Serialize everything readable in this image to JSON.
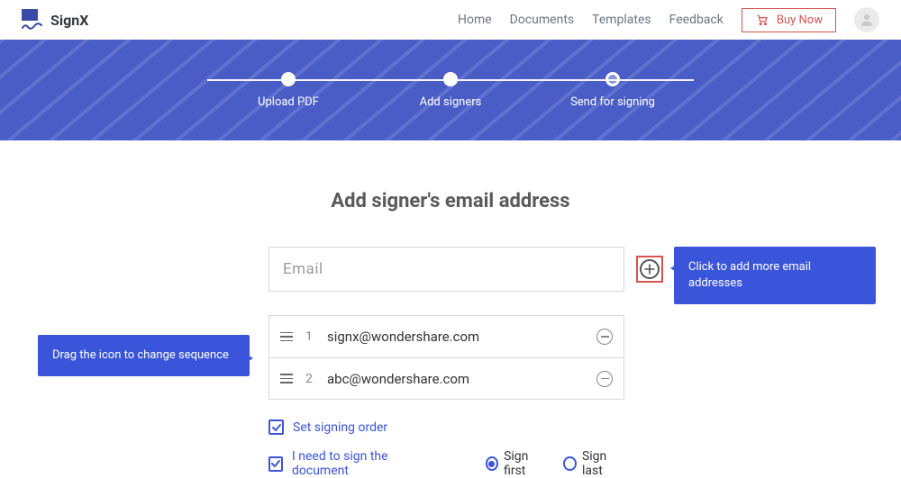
{
  "brand": {
    "name": "SignX"
  },
  "nav": {
    "home": "Home",
    "documents": "Documents",
    "templates": "Templates",
    "feedback": "Feedback",
    "buy": "Buy Now"
  },
  "progress": {
    "step1": "Upload PDF",
    "step2": "Add signers",
    "step3": "Send for signing"
  },
  "title": "Add signer's email address",
  "email_placeholder": "Email",
  "signers": [
    {
      "n": "1",
      "email": "signx@wondershare.com"
    },
    {
      "n": "2",
      "email": "abc@wondershare.com"
    }
  ],
  "options": {
    "order": "Set signing order",
    "selfsign": "I need to sign the document",
    "first": "Sign first",
    "last": "Sign last"
  },
  "tips": {
    "drag": "Drag the icon to change sequence",
    "add": "Click to add more email addresses"
  }
}
